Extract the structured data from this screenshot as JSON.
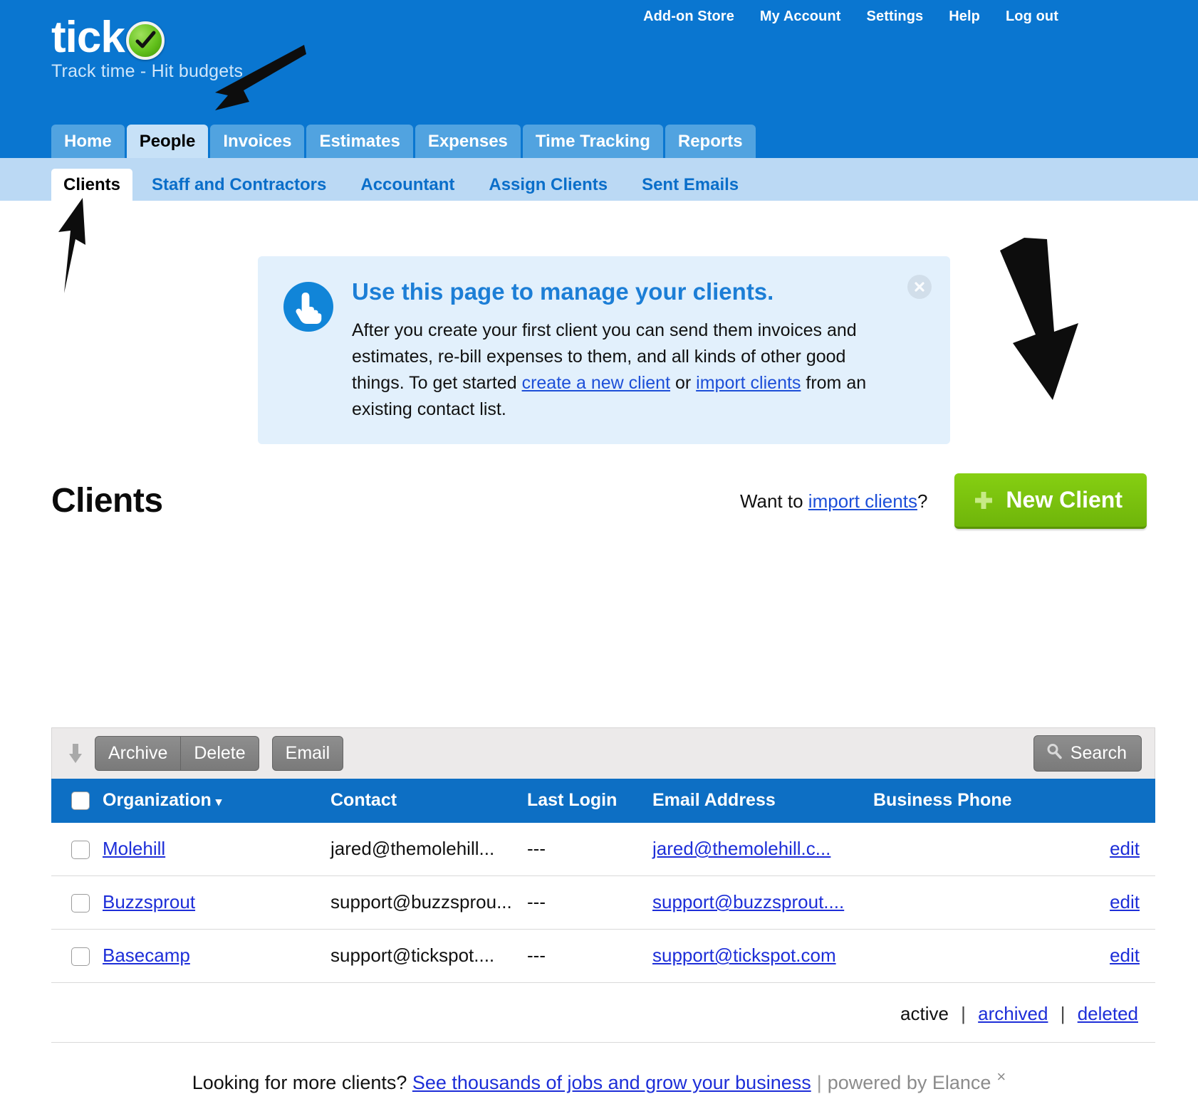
{
  "brand": {
    "logo_text": "tick",
    "logo_mark": "green-check-circle",
    "tagline": "Track time - Hit budgets"
  },
  "topnav": {
    "items": [
      {
        "label": "Add-on Store"
      },
      {
        "label": "My Account"
      },
      {
        "label": "Settings"
      },
      {
        "label": "Help"
      },
      {
        "label": "Log out"
      }
    ]
  },
  "main_tabs": [
    {
      "label": "Home",
      "active": false
    },
    {
      "label": "People",
      "active": true
    },
    {
      "label": "Invoices",
      "active": false
    },
    {
      "label": "Estimates",
      "active": false
    },
    {
      "label": "Expenses",
      "active": false
    },
    {
      "label": "Time Tracking",
      "active": false
    },
    {
      "label": "Reports",
      "active": false
    }
  ],
  "sub_tabs": [
    {
      "label": "Clients",
      "active": true
    },
    {
      "label": "Staff and Contractors",
      "active": false
    },
    {
      "label": "Accountant",
      "active": false
    },
    {
      "label": "Assign Clients",
      "active": false
    },
    {
      "label": "Sent Emails",
      "active": false
    }
  ],
  "notice": {
    "icon": "pointing-hand-icon",
    "title": "Use this page to manage your clients.",
    "body_part1": "After you create your first client you can send them invoices and estimates, re-bill expenses to them, and all kinds of other good things. To get started ",
    "link1": "create a new client",
    "body_part2": " or ",
    "link2": "import clients",
    "body_part3": " from an existing contact list.",
    "close_label": "×"
  },
  "page": {
    "title": "Clients",
    "import_prefix": "Want to ",
    "import_link": "import clients",
    "import_suffix": "?",
    "new_client_label": "New Client"
  },
  "toolbar": {
    "archive_label": "Archive",
    "delete_label": "Delete",
    "email_label": "Email",
    "search_label": "Search"
  },
  "table": {
    "columns": [
      {
        "label": "Organization",
        "sort": "▾"
      },
      {
        "label": "Contact"
      },
      {
        "label": "Last Login"
      },
      {
        "label": "Email Address"
      },
      {
        "label": "Business Phone"
      }
    ],
    "rows": [
      {
        "organization": "Molehill",
        "contact": "jared@themolehill...",
        "last_login": "---",
        "email": "jared@themolehill.c...",
        "phone": "",
        "edit_label": "edit"
      },
      {
        "organization": "Buzzsprout",
        "contact": "support@buzzsprou...",
        "last_login": "---",
        "email": "support@buzzsprout....",
        "phone": "",
        "edit_label": "edit"
      },
      {
        "organization": "Basecamp",
        "contact": "support@tickspot....",
        "last_login": "---",
        "email": "support@tickspot.com",
        "phone": "",
        "edit_label": "edit"
      }
    ]
  },
  "status_filters": {
    "active": "active",
    "archived": "archived",
    "deleted": "deleted",
    "separator": "|"
  },
  "elance_bar": {
    "prefix": "Looking for more clients? ",
    "link": "See thousands of jobs and grow your business",
    "separator": "|",
    "powered": "powered by Elance",
    "close": "×"
  },
  "colors": {
    "header_blue": "#0a76d0",
    "subnav_blue": "#bbd9f4",
    "table_header_blue": "#0d6fc4",
    "green_button": "#7ac20e",
    "link_blue": "#1d2ed8",
    "notice_bg": "#e2f0fc"
  }
}
